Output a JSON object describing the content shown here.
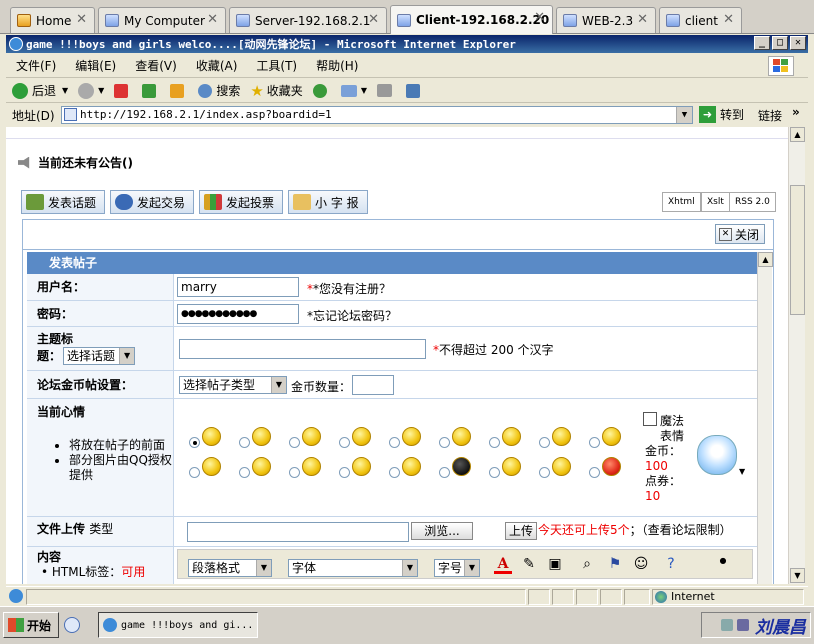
{
  "host_tabs": [
    {
      "label": "Home",
      "active": false
    },
    {
      "label": "My Computer",
      "active": false
    },
    {
      "label": "Server-192.168.2.1",
      "active": false
    },
    {
      "label": "Client-192.168.2.20",
      "active": true
    },
    {
      "label": "WEB-2.3",
      "active": false
    },
    {
      "label": "client",
      "active": false
    }
  ],
  "window": {
    "title": "game !!!boys and girls welco....[动网先锋论坛] - Microsoft Internet Explorer"
  },
  "menu": [
    "文件(F)",
    "编辑(E)",
    "查看(V)",
    "收藏(A)",
    "工具(T)",
    "帮助(H)"
  ],
  "toolbar": {
    "back": "后退",
    "search": "搜索",
    "favorites": "收藏夹"
  },
  "address": {
    "label": "地址(D)",
    "url": "http://192.168.2.1/index.asp?boardid=1",
    "go": "转到",
    "links": "链接"
  },
  "notice": "当前还未有公告()",
  "actions": [
    "发表话题",
    "发起交易",
    "发起投票",
    "小 字 报"
  ],
  "feeds": [
    "Xhtml",
    "Xslt",
    "RSS 2.0"
  ],
  "close_label": "关闭",
  "form": {
    "header": "发表帖子",
    "username_label": "用户名：",
    "username_value": "marry",
    "register_hint": "*您没有注册？",
    "password_label": "密码：",
    "password_value": "●●●●●●●●●●●",
    "forgot_hint": "*忘记论坛密码？",
    "subject_label_1": "主题标",
    "subject_label_2": "题：",
    "subject_select": "选择话题",
    "subject_hint_star": "*",
    "subject_hint": "不得超过 200 个汉字",
    "gold_label": "论坛金币帖设置：",
    "gold_select": "选择帖子类型",
    "gold_amount_label": "金币数量：",
    "mood_label": "当前心情",
    "mood_notes": [
      "将放在帖子的前面",
      "部分图片由QQ授权提供"
    ],
    "magic_label": "魔法表情",
    "magic_gold_label": "金币：",
    "magic_gold_value": "100",
    "magic_coupon_label": "点券：",
    "magic_coupon_value": "10",
    "upload_label": "文件上传",
    "upload_type": "类型",
    "browse_label": "浏览...",
    "upload_button": "上传",
    "upload_hint_red": "今天还可上传5个",
    "upload_hint_rest": "；（查看论坛限制）",
    "content_label": "内容",
    "html_label": "HTML标签：",
    "html_value": "可用",
    "paragraph_select": "段落格式",
    "font_select": "字体",
    "size_select": "字号"
  },
  "status": {
    "zone": "Internet"
  },
  "taskbar": {
    "start": "开始",
    "item": "game !!!boys and gi...",
    "clock": "刘晨昌"
  }
}
